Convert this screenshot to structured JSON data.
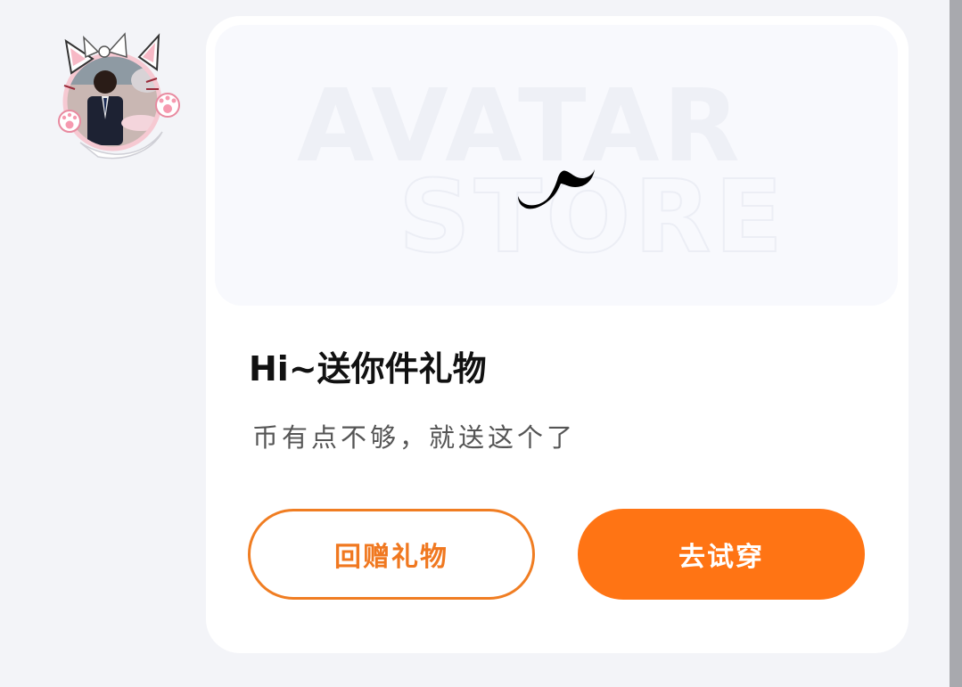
{
  "avatar": {
    "frame_icon": "cat-ear-bow-frame"
  },
  "preview": {
    "watermark_line1": "AVATAR",
    "watermark_line2": "STORE",
    "item_icon": "mustache-icon"
  },
  "gift": {
    "title": "Hi~送你件礼物",
    "subtitle": "币有点不够，就送这个了"
  },
  "buttons": {
    "return_gift_label": "回赠礼物",
    "try_on_label": "去试穿"
  },
  "colors": {
    "accent": "#ff7414",
    "page_background": "#f3f4f8",
    "card_background": "#ffffff"
  }
}
